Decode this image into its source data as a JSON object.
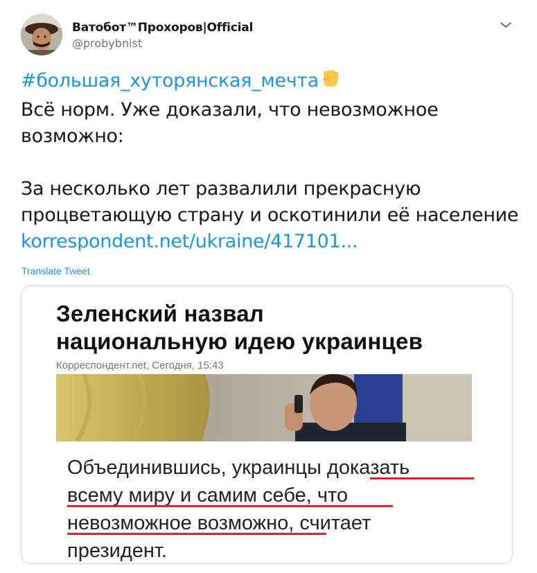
{
  "author": {
    "display_name": "Ватобот™Прохоров|Official",
    "handle": "@probybnist"
  },
  "tweet": {
    "hashtag": "#большая_хуторянская_мечта",
    "emoji": "raised-fist",
    "line2": "Всё норм. Уже доказали, что невозможное",
    "line3": "возможно:",
    "line4": "За несколько лет развалили прекрасную",
    "line5": "процветающую страну и оскотинили её население",
    "link": "korrespondent.net/ukraine/417101..."
  },
  "translate_label": "Translate Tweet",
  "card": {
    "headline_line1": "Зеленский назвал",
    "headline_line2": "национальную идею украинцев",
    "source": "Корреспондент.net, Сегодня, 15:43",
    "lead_line1": "Объединившись, украинцы доказать",
    "lead_line2": "всему миру и самим себе, что",
    "lead_line3": "невозможное возможно, считает",
    "lead_line4": "президент.",
    "underline_color": "#e3242b"
  },
  "colors": {
    "link": "#1b95e0",
    "text": "#14171a",
    "secondary": "#657786"
  },
  "icons": [
    "avatar",
    "chevron-down-icon",
    "raised-fist-emoji"
  ]
}
